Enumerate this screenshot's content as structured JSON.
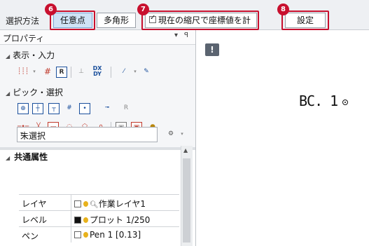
{
  "toolbar": {
    "method_label": "選択方法",
    "arbitrary_point_label": "任意点",
    "polygon_label": "多角形",
    "compute_coords_label": "現在の縮尺で座標値を計算",
    "settings_label": "設定",
    "badges": [
      "6",
      "7",
      "8"
    ]
  },
  "panel": {
    "title": "プロパティ",
    "controls": [
      "▾",
      "ꟼ"
    ],
    "sections": {
      "display_input": "表示・入力",
      "pick_select": "ピック・選択"
    },
    "selection_combo": {
      "value": "未選択"
    },
    "grid": {
      "group_title": "共通属性",
      "rows": [
        {
          "key": "レイヤ",
          "value": "作業レイヤ1"
        },
        {
          "key": "レベル",
          "value": "プロット 1/250"
        },
        {
          "key": "ペン",
          "value": "Pen 1 [0.13]"
        }
      ]
    }
  },
  "canvas": {
    "info_icon": "!",
    "label": "BC. 1"
  },
  "colors": {
    "callout": "#c8102e",
    "active_button": "#cfe3f6",
    "icon_blue": "#1a4f9c"
  },
  "icons": [
    "checkbox-icon",
    "pin-icon",
    "dropdown-arrow-icon",
    "info-icon",
    "target-circle-icon",
    "lightbulb-icon",
    "magnifier-icon",
    "settings-gear-icon",
    "color-swatch-icon"
  ]
}
